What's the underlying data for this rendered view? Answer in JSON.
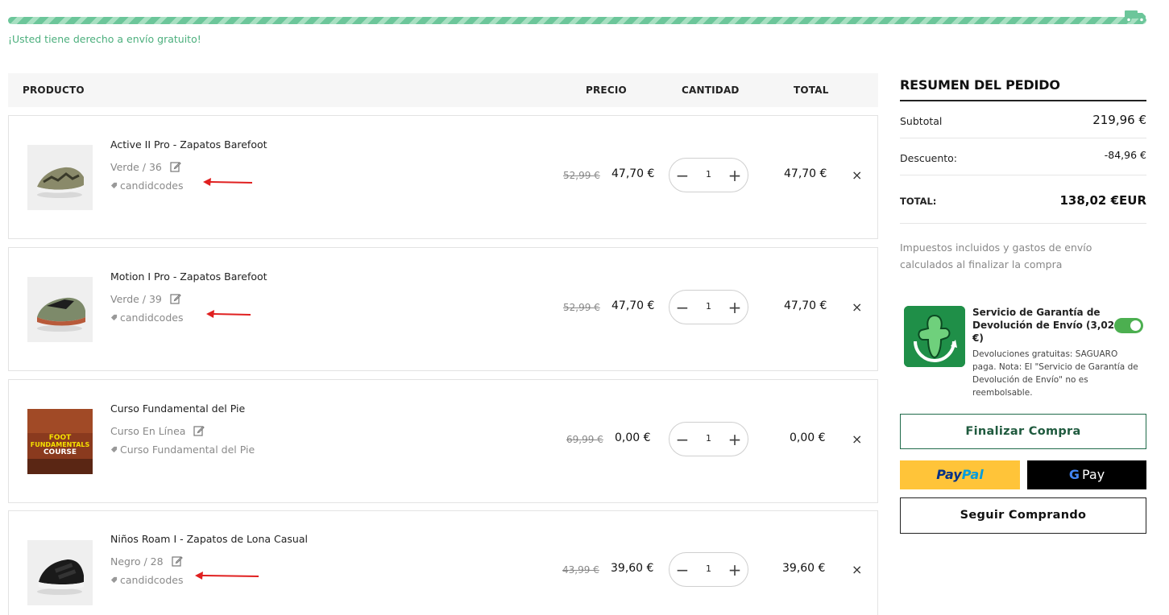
{
  "shipping": {
    "message": "¡Usted tiene derecho a envío gratuito!",
    "progress": 1.0,
    "icon": "truck-icon"
  },
  "table": {
    "headers": {
      "product": "PRODUCTO",
      "price": "PRECIO",
      "quantity": "CANTIDAD",
      "total": "TOTAL"
    }
  },
  "items": [
    {
      "name": "Active II Pro - Zapatos Barefoot",
      "variant": "Verde / 36",
      "code": "candidcodes",
      "old_price": "52,99 €",
      "price": "47,70 €",
      "qty": "1",
      "total": "47,70 €",
      "remove": "×"
    },
    {
      "name": "Motion I Pro - Zapatos Barefoot",
      "variant": "Verde / 39",
      "code": "candidcodes",
      "old_price": "52,99 €",
      "price": "47,70 €",
      "qty": "1",
      "total": "47,70 €",
      "remove": "×"
    },
    {
      "name": "Curso Fundamental del Pie",
      "variant": "Curso En Línea",
      "code": "Curso Fundamental del Pie",
      "old_price": "69,99 €",
      "price": "0,00 €",
      "qty": "1",
      "total": "0,00 €",
      "remove": "×",
      "thumb_text": [
        "FOOT",
        "FUNDAMENTALS",
        "COURSE"
      ]
    },
    {
      "name": "Niños Roam I - Zapatos de Lona Casual",
      "variant": "Negro / 28",
      "code": "candidcodes",
      "old_price": "43,99 €",
      "price": "39,60 €",
      "qty": "1",
      "total": "39,60 €",
      "remove": "×"
    }
  ],
  "qty_controls": {
    "minus": "−",
    "plus": "+"
  },
  "summary": {
    "title": "RESUMEN DEL PEDIDO",
    "subtotal_label": "Subtotal",
    "subtotal_value": "219,96 €",
    "discount_label": "Descuento:",
    "discount_value": "-84,96 €",
    "total_label": "TOTAL:",
    "total_value": "138,02 €EUR",
    "taxes_note": "Impuestos incluidos y gastos de envío calculados al finalizar la compra"
  },
  "warranty": {
    "title": "Servicio de Garantía de Devolución de Envío (3,02 €)",
    "description": "Devoluciones gratuitas: SAGUARO paga. Nota: El \"Servicio de Garantía de Devolución de Envío\" no es reembolsable.",
    "enabled": true
  },
  "buttons": {
    "checkout": "Finalizar Compra",
    "paypal_a": "Pay",
    "paypal_b": "Pal",
    "gpay_g": "G",
    "gpay_text": "Pay",
    "continue": "Seguir Comprando"
  },
  "colors": {
    "accent_green": "#4caf7d",
    "toggle_green": "#4caf50",
    "checkout_border": "#1f6b4a",
    "paypal_yellow": "#ffc439",
    "annotation_red": "#e02020"
  }
}
